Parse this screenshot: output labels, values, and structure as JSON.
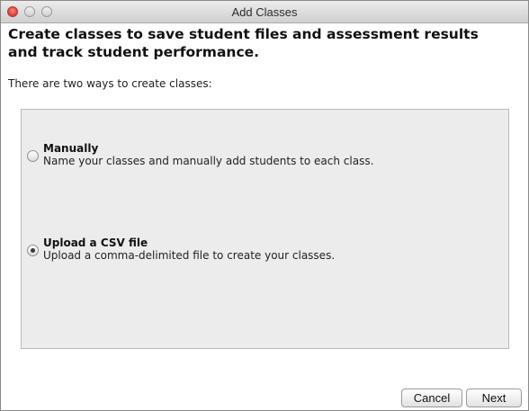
{
  "window": {
    "title": "Add Classes"
  },
  "main": {
    "heading": "Create classes to save student files and assessment results and track student performance.",
    "intro": "There are two ways to create classes:"
  },
  "options": [
    {
      "label": "Manually",
      "description": "Name your classes and manually add students to each class.",
      "selected": false
    },
    {
      "label": "Upload a CSV file",
      "description": "Upload a comma-delimited file to create your classes.",
      "selected": true
    }
  ],
  "buttons": {
    "cancel": "Cancel",
    "next": "Next"
  },
  "colors": {
    "close_button": "#e0433b",
    "panel_background": "#ececec"
  }
}
